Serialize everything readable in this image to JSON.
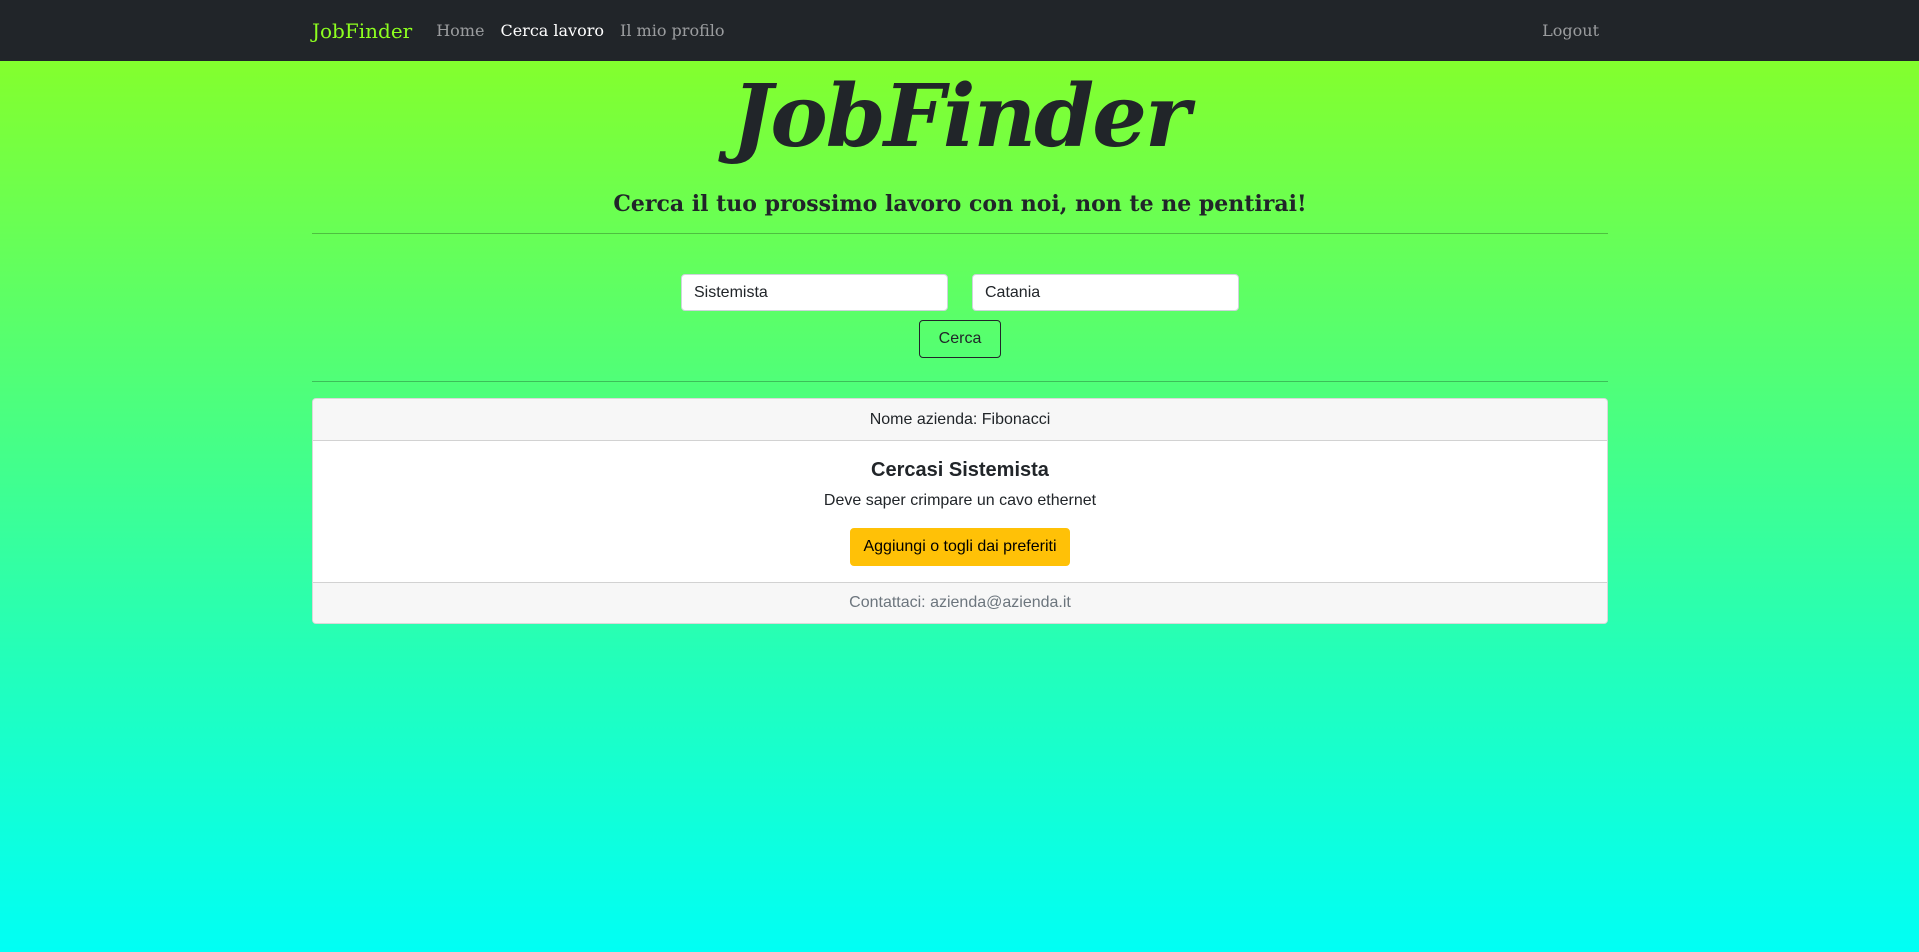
{
  "navbar": {
    "brand": "JobFinder",
    "links": [
      {
        "label": "Home",
        "active": false
      },
      {
        "label": "Cerca lavoro",
        "active": true
      },
      {
        "label": "Il mio profilo",
        "active": false
      }
    ],
    "logout": "Logout"
  },
  "hero": {
    "title": "JobFinder",
    "subtitle": "Cerca il tuo prossimo lavoro con noi, non te ne pentirai!"
  },
  "search": {
    "job_value": "Sistemista",
    "location_value": "Catania",
    "button": "Cerca"
  },
  "results": [
    {
      "header": "Nome azienda: Fibonacci",
      "title": "Cercasi Sistemista",
      "description": "Deve saper crimpare un cavo ethernet",
      "favorite_button": "Aggiungi o togli dai preferiti",
      "footer": "Contattaci: azienda@azienda.it"
    }
  ],
  "colors": {
    "brand": "#8dff1f",
    "navbar_bg": "#212529",
    "favorite_button": "#ffc107",
    "gradient_top": "#8dff1f",
    "gradient_bottom": "#00fff5"
  }
}
